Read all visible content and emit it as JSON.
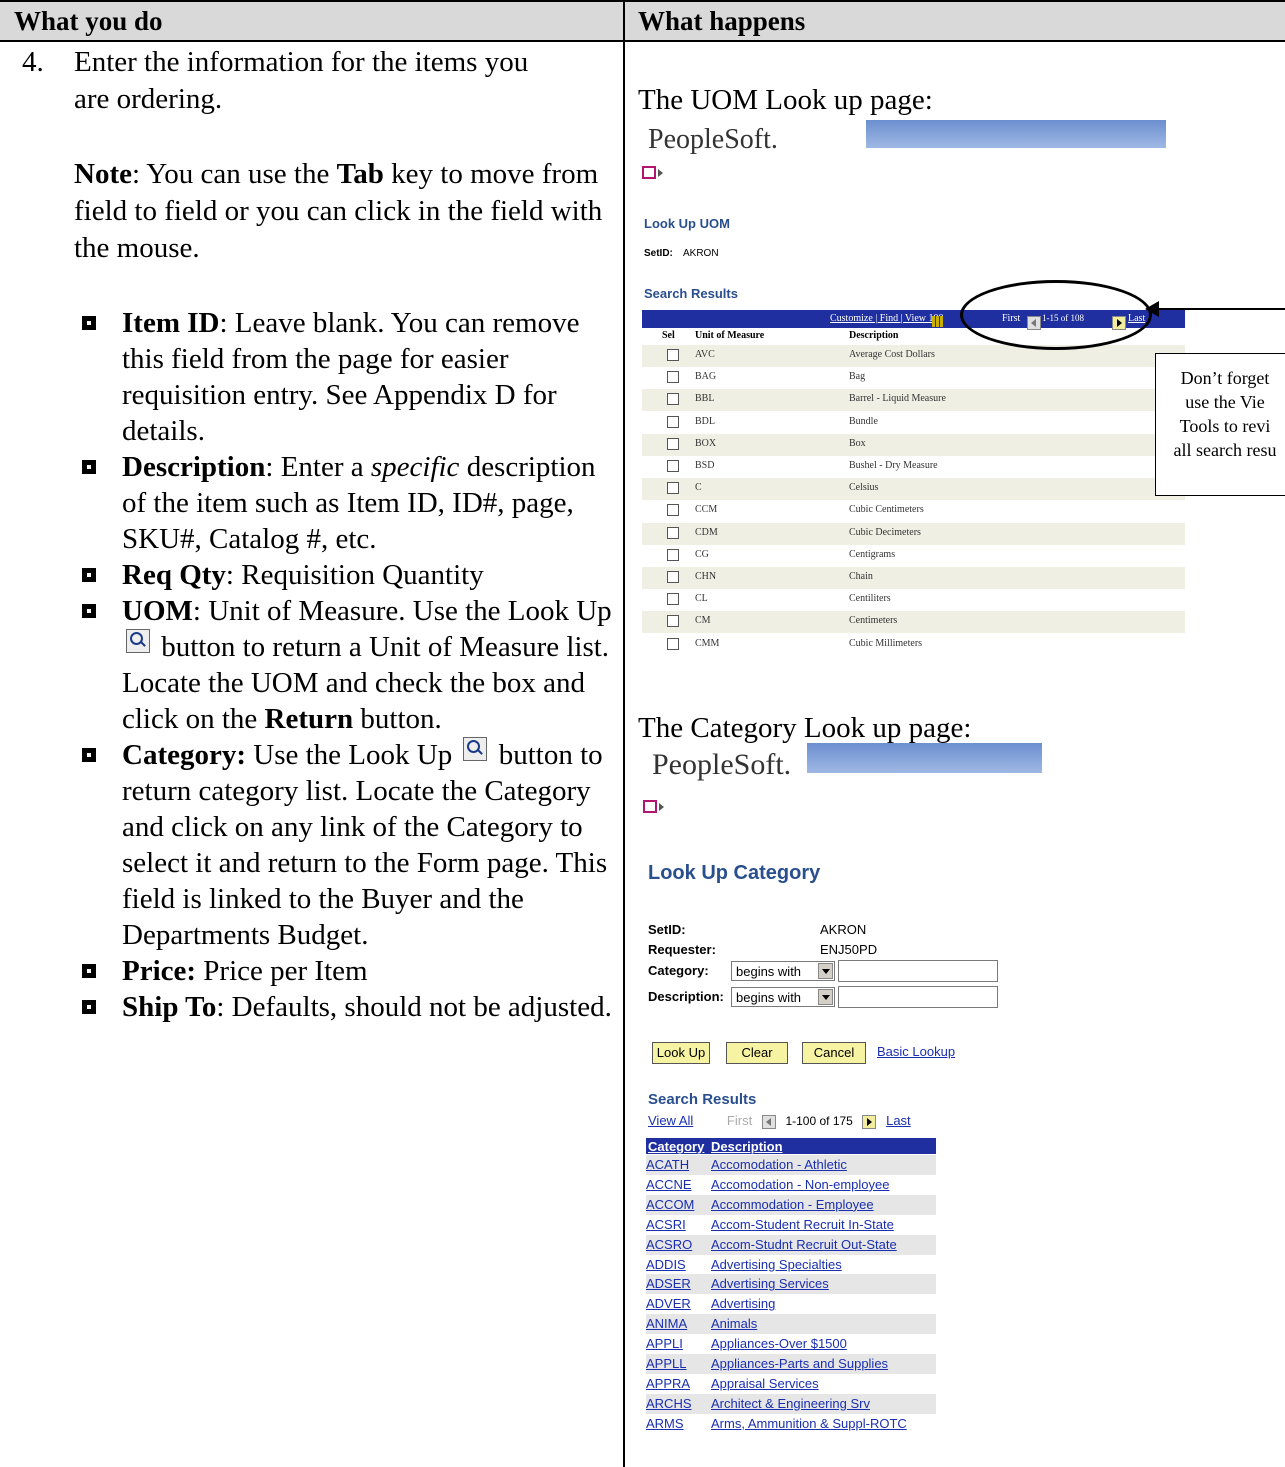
{
  "header": {
    "left": "What you do",
    "right": "What happens"
  },
  "step": {
    "number": "4.",
    "text_line1": "Enter the information for the items you",
    "text_line2": "are ordering."
  },
  "note": {
    "label": "Note",
    "text1": ":  You can use the ",
    "key": "Tab",
    "text2": " key to move from field to field or you can click in the field with the mouse."
  },
  "bullets": [
    {
      "term": "Item ID",
      "sep": ":  ",
      "text": "Leave blank.  You can remove this field from the page for easier requisition entry.  See Appendix D for details."
    },
    {
      "term": "Description",
      "sep": ":  ",
      "text_a": "Enter a ",
      "emph": "specific",
      "text_b": " description of the item such as Item ID, ID#, page, SKU#, Catalog #, etc."
    },
    {
      "term": "Req Qty",
      "sep": ":  ",
      "text": "Requisition Quantity"
    },
    {
      "term": "UOM",
      "sep": ":  ",
      "text_a": "Unit of Measure.  Use the Look Up ",
      "text_b": " button to return a Unit of Measure list.  Locate the UOM and check the box and click on the ",
      "bold": "Return",
      "text_c": " button."
    },
    {
      "term": "Category:",
      "sep": "  ",
      "text_a": "Use the Look Up ",
      "text_b": " button to return category list.  Locate the Category and click on any link of the Category to select it and return to the Form page.  This field is linked to the Buyer and the Departments Budget."
    },
    {
      "term": "Price:",
      "sep": "  ",
      "text": "Price per Item"
    },
    {
      "term": "Ship To",
      "sep": ":  ",
      "text": "Defaults, should not be adjusted."
    }
  ],
  "uom_section": {
    "title": "The UOM Look up page:",
    "logo": "PeopleSoft.",
    "page_title": "Look Up UOM",
    "setid_label": "SetID:",
    "setid_value": "AKRON",
    "results_title": "Search Results",
    "toolbar": {
      "customize": "Customize | Find | View 100",
      "first": "First",
      "range": "1-15 of 108",
      "last": "Last"
    },
    "columns": [
      "Sel",
      "Unit of Measure",
      "Description"
    ],
    "rows": [
      [
        "AVC",
        "Average Cost Dollars"
      ],
      [
        "BAG",
        "Bag"
      ],
      [
        "BBL",
        "Barrel - Liquid Measure"
      ],
      [
        "BDL",
        "Bundle"
      ],
      [
        "BOX",
        "Box"
      ],
      [
        "BSD",
        "Bushel - Dry Measure"
      ],
      [
        "C",
        "Celsius"
      ],
      [
        "CCM",
        "Cubic Centimeters"
      ],
      [
        "CDM",
        "Cubic Decimeters"
      ],
      [
        "CG",
        "Centigrams"
      ],
      [
        "CHN",
        "Chain"
      ],
      [
        "CL",
        "Centiliters"
      ],
      [
        "CM",
        "Centimeters"
      ],
      [
        "CMM",
        "Cubic Millimeters"
      ]
    ]
  },
  "callout": {
    "lines": [
      "Don’t forget",
      "use the Vie",
      "Tools to revi",
      "all search resu"
    ]
  },
  "category_section": {
    "title": "The Category Look up page:",
    "logo": "PeopleSoft.",
    "page_title": "Look Up Category",
    "fields": {
      "setid_label": "SetID:",
      "setid_value": "AKRON",
      "requester_label": "Requester:",
      "requester_value": "ENJ50PD",
      "category_label": "Category:",
      "category_op": "begins with",
      "description_label": "Description:",
      "description_op": "begins with"
    },
    "buttons": {
      "lookup": "Look Up",
      "clear": "Clear",
      "cancel": "Cancel",
      "basic": "Basic Lookup"
    },
    "results_title": "Search Results",
    "nav": {
      "view_all": "View All",
      "first": "First",
      "range": "1-100 of 175",
      "last": "Last"
    },
    "columns": [
      "Category",
      "Description"
    ],
    "rows": [
      [
        "ACATH",
        "Accomodation - Athletic"
      ],
      [
        "ACCNE",
        "Accomodation - Non-employee"
      ],
      [
        "ACCOM",
        "Accommodation - Employee"
      ],
      [
        "ACSRI",
        "Accom-Student Recruit In-State"
      ],
      [
        "ACSRO",
        "Accom-Studnt Recruit Out-State"
      ],
      [
        "ADDIS",
        "Advertising Specialties"
      ],
      [
        "ADSER",
        "Advertising Services"
      ],
      [
        "ADVER",
        "Advertising"
      ],
      [
        "ANIMA",
        "Animals"
      ],
      [
        "APPLI",
        "Appliances-Over $1500"
      ],
      [
        "APPLL",
        "Appliances-Parts and Supplies"
      ],
      [
        "APPRA",
        "Appraisal Services"
      ],
      [
        "ARCHS",
        "Architect & Engineering Srv"
      ],
      [
        "ARMS",
        "Arms, Ammunition & Suppl-ROTC"
      ]
    ]
  }
}
